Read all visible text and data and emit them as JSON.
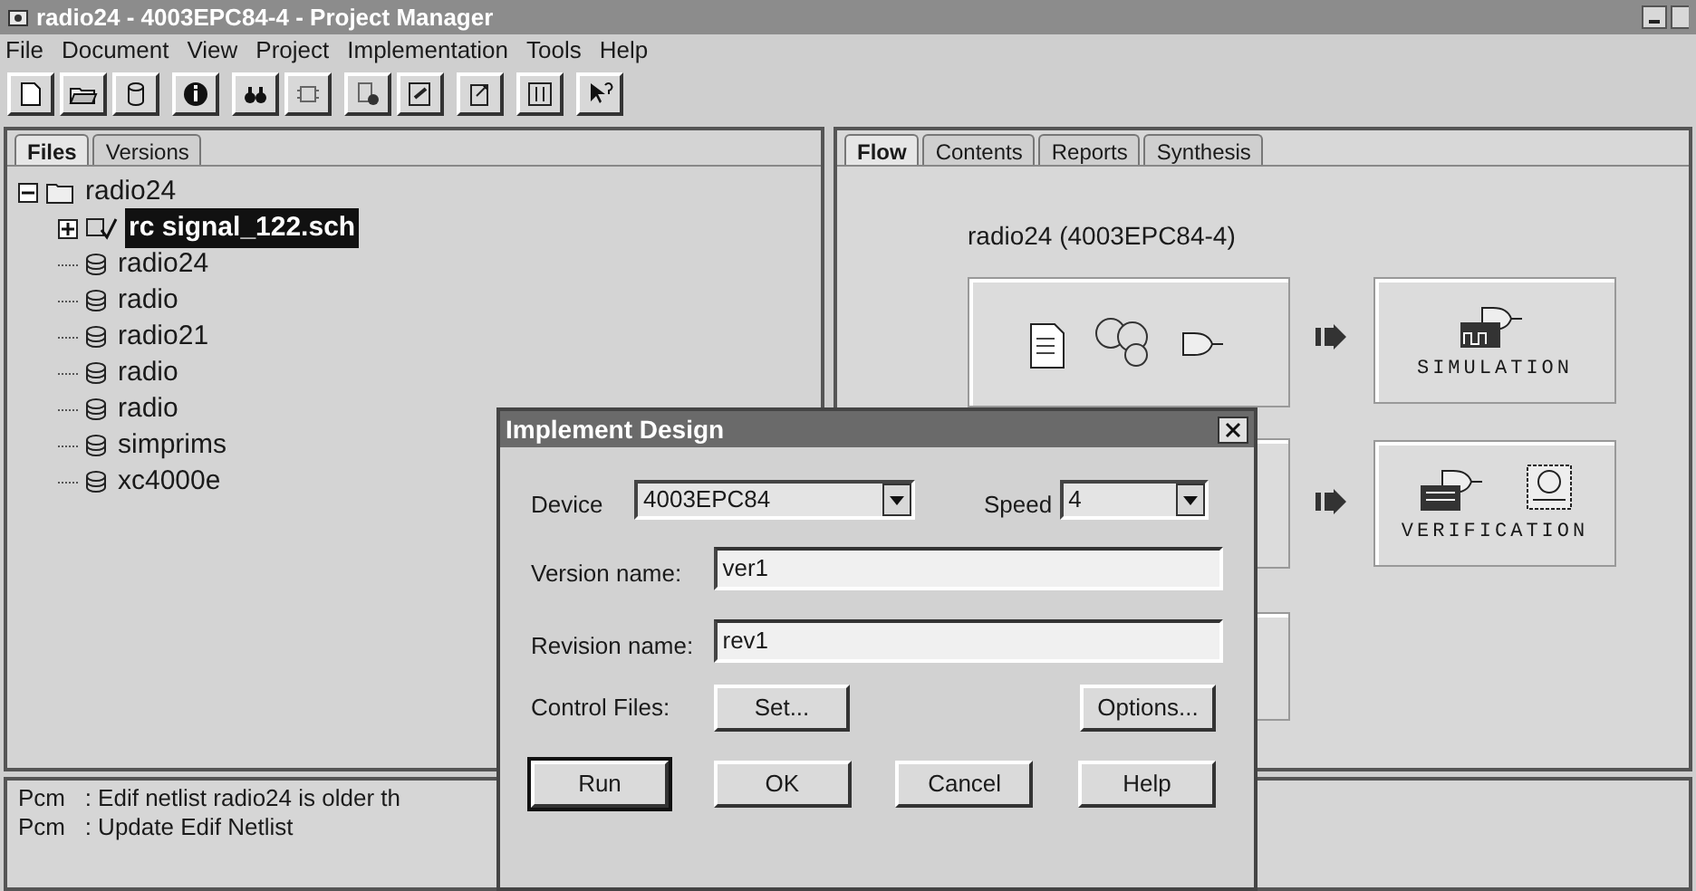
{
  "window": {
    "title": "radio24 - 4003EPC84-4 - Project Manager"
  },
  "menu": [
    "File",
    "Document",
    "View",
    "Project",
    "Implementation",
    "Tools",
    "Help"
  ],
  "left_tabs": [
    {
      "label": "Files",
      "selected": true
    },
    {
      "label": "Versions",
      "selected": false
    }
  ],
  "tree": [
    {
      "label": "radio24",
      "kind": "project",
      "expanded": true,
      "children": [
        {
          "label": "rc signal_122.sch",
          "kind": "schematic",
          "expanded": false,
          "selected": true
        },
        {
          "label": "radio24",
          "kind": "library",
          "selected": false
        },
        {
          "label": "radio",
          "kind": "library",
          "selected": false
        },
        {
          "label": "radio21",
          "kind": "library",
          "selected": false
        },
        {
          "label": "radio",
          "kind": "library",
          "selected": false
        },
        {
          "label": "radio",
          "kind": "library",
          "selected": false
        },
        {
          "label": "simprims",
          "kind": "library",
          "selected": false
        },
        {
          "label": "xc4000e",
          "kind": "library",
          "selected": false
        }
      ]
    }
  ],
  "right_tabs": [
    {
      "label": "Flow",
      "selected": true
    },
    {
      "label": "Contents",
      "selected": false
    },
    {
      "label": "Reports",
      "selected": false
    },
    {
      "label": "Synthesis",
      "selected": false
    }
  ],
  "flow": {
    "heading": "radio24 (4003EPC84-4)",
    "steps": [
      {
        "kind": "entry"
      },
      {
        "kind": "simulation",
        "label": "SIMULATION"
      },
      {
        "kind": "implementation"
      },
      {
        "kind": "verification",
        "label": "VERIFICATION"
      },
      {
        "kind": "programming"
      }
    ]
  },
  "log": [
    "Pcm   : Edif netlist radio24 is older th",
    "Pcm   : Update Edif Netlist"
  ],
  "dialog": {
    "title": "Implement Design",
    "device_label": "Device",
    "device": "4003EPC84",
    "speed_label": "Speed",
    "speed": "4",
    "version_label": "Version name:",
    "version": "ver1",
    "revision_label": "Revision name:",
    "revision": "rev1",
    "control_label": "Control Files:",
    "set_button": "Set...",
    "options_button": "Options...",
    "buttons": [
      {
        "label": "Run",
        "default": true
      },
      {
        "label": "OK",
        "default": false
      },
      {
        "label": "Cancel",
        "default": false
      },
      {
        "label": "Help",
        "default": false
      }
    ]
  }
}
